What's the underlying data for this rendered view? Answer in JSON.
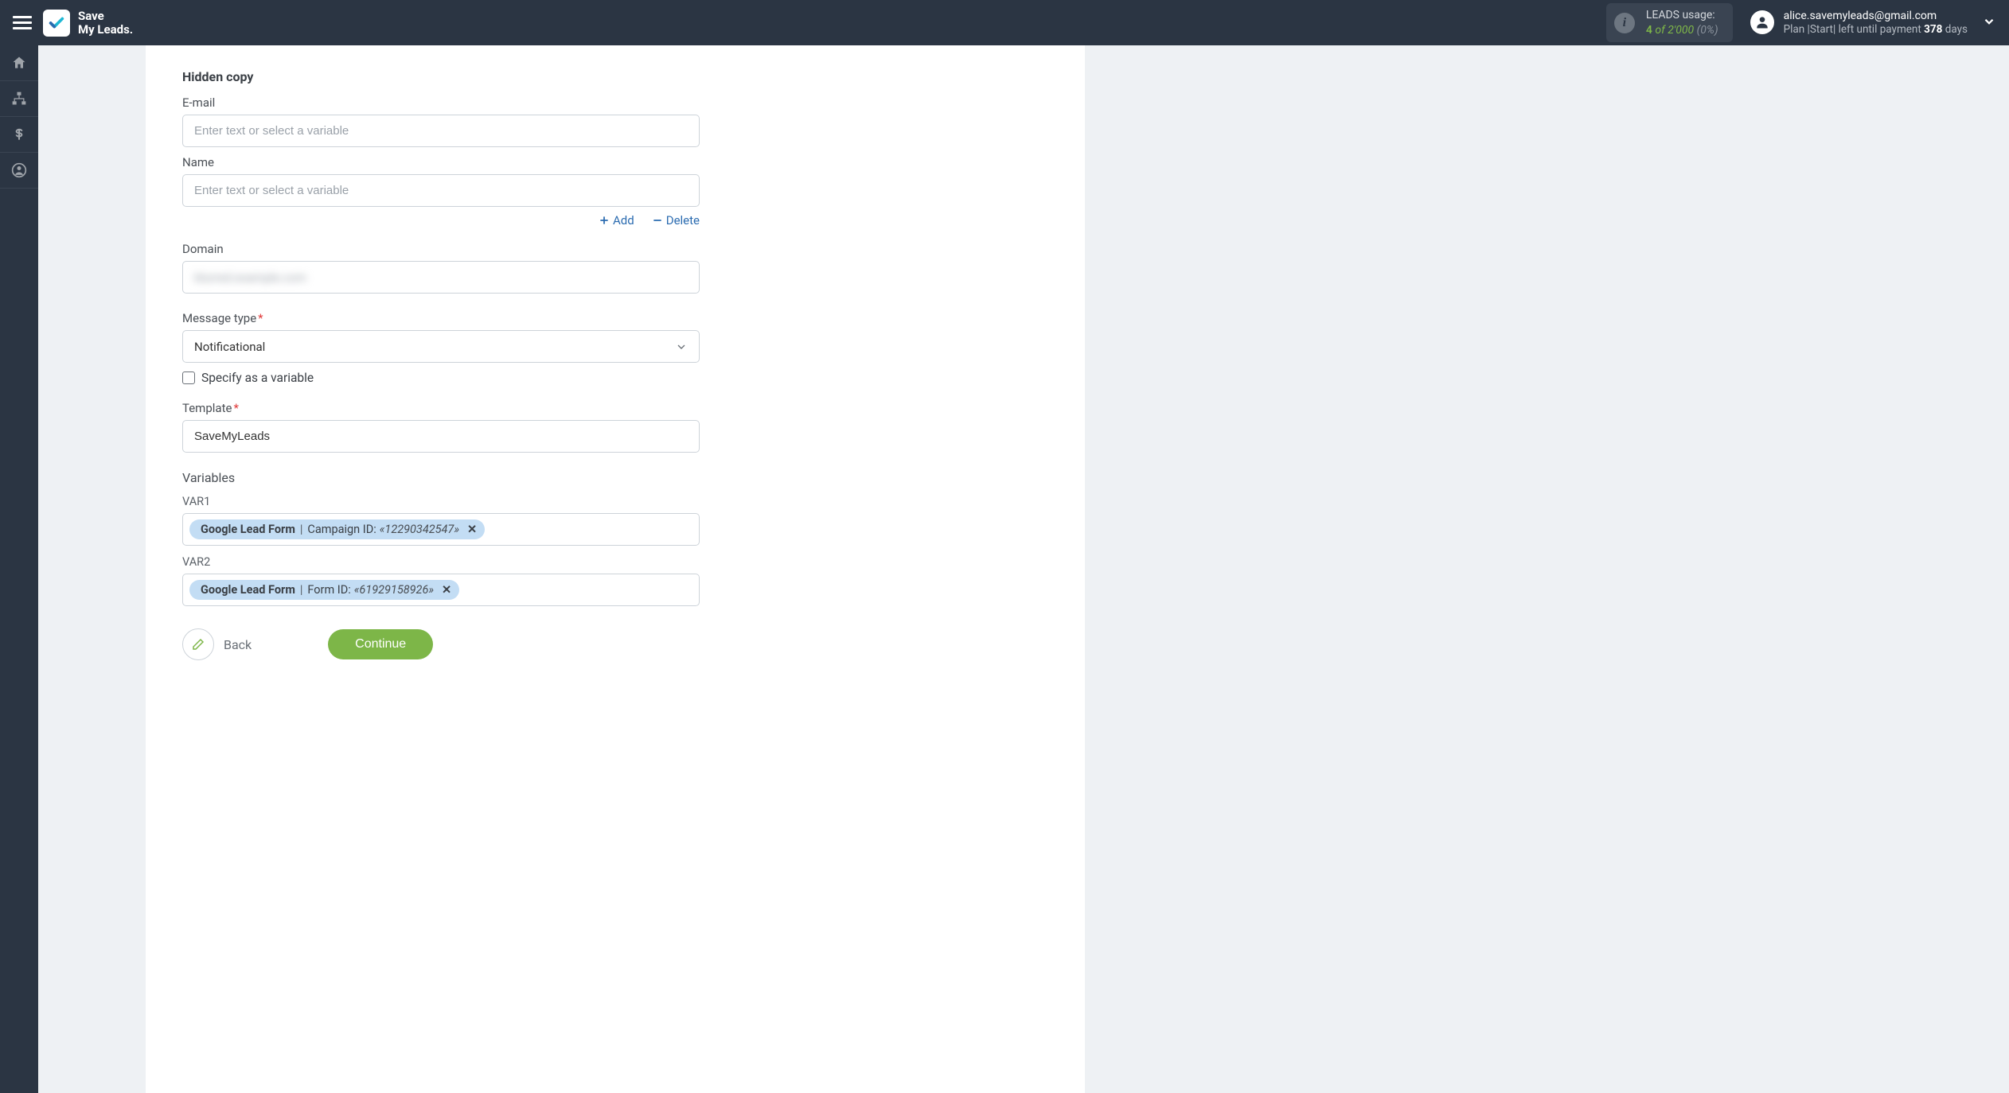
{
  "header": {
    "logo_line1": "Save",
    "logo_line2": "My Leads.",
    "usage": {
      "label": "LEADS usage:",
      "count": "4",
      "of_word": "of",
      "total": "2'000",
      "pct": "(0%)"
    },
    "account": {
      "email": "alice.savemyleads@gmail.com",
      "plan_prefix": "Plan |",
      "plan_name": "Start",
      "plan_middle": "| left until payment",
      "days_left": "378",
      "days_suffix": "days"
    }
  },
  "form": {
    "hidden_copy_title": "Hidden copy",
    "email_label": "E-mail",
    "name_label": "Name",
    "placeholder": "Enter text or select a variable",
    "add_label": "Add",
    "delete_label": "Delete",
    "domain_label": "Domain",
    "domain_value": "blurred.example.com",
    "message_type_label": "Message type",
    "message_type_value": "Notificational",
    "specify_variable_label": "Specify as a variable",
    "template_label": "Template",
    "template_value": "SaveMyLeads",
    "variables_label": "Variables",
    "var1_label": "VAR1",
    "var2_label": "VAR2",
    "var1_chip": {
      "source": "Google Lead Form",
      "field": "Campaign ID:",
      "value": "«12290342547»"
    },
    "var2_chip": {
      "source": "Google Lead Form",
      "field": "Form ID:",
      "value": "«61929158926»"
    },
    "back_label": "Back",
    "continue_label": "Continue"
  }
}
